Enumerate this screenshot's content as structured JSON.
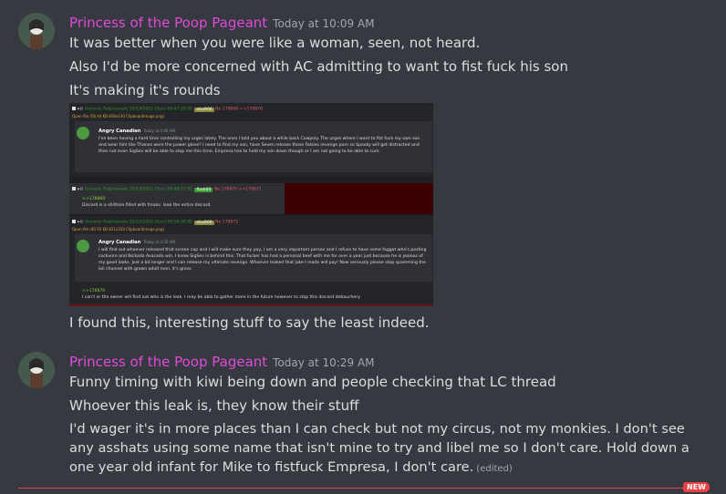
{
  "messages": [
    {
      "username": "Princess of the Poop Pageant",
      "timestamp": "Today at 10:09 AM",
      "lines": [
        "It was better when you were like a woman, seen, not heard.",
        "Also I'd be more concerned with AC admitting to want to fist fuck his son",
        "It's making it's rounds",
        "I found this, interesting stuff to say the least indeed."
      ],
      "embed": {
        "post1": {
          "header": "Unironic Ralphamale  10/23/2022 (Sun) 09:47:20 ID:",
          "id": "eba906",
          "num": "No.178869",
          "replies": ">>178876",
          "file": "Open file (58.44 KB 836x130 Clipboardimage.png)",
          "quote_name": "Angry Canadian",
          "quote_time": "Today at 4:46 AM",
          "quote_text": "I've been having a hard time controlling my urges lately. The ones I told you about a while back Cowpoly. The urges where I want to fist fuck my own son and wear him like Thanos wore the power glove? I need to find my son, have Seven release those Falsies revenge porn so Spooky will get distracted and then not even SigSev will be able to stop me this time. Empresa has to hold my son down though or I am not going to be able to cum."
        },
        "post2": {
          "header": "Unironic Ralphamale  10/23/2022 (Sun) 09:48:57 ID:",
          "id": "fbab00",
          "num": "No.178870",
          "replies": ">>178871",
          "reply_link": ">>178869",
          "text": "Discord is a shithole filled with freaks. leak the entire discord."
        },
        "post3": {
          "header": "Unironic Ralphamale  10/23/2022 (Sun) 09:56:08 ID:",
          "id": "eba906",
          "num": "No.178871",
          "file": "Open file (40.93 KB 831x150 Clipboardimage.png)",
          "quote_name": "Angry Canadian",
          "quote_time": "Today at 4:35 AM",
          "quote_text": "I will find out whoever released that screen cap and I will make sure they pay, I am a very important person and I refuse to have some faggot who's posting cockvore and Nickado Avacado win. I know SigSev is behind this. That fucker has had a personal beef with me for over a year just because he is jealous of my good looks. Just a bit longer and I can release my ultimate revenge. Whoever leaked that joke I made will pay! Now seriously please stop spamming the loli channel with grown adult men, it's gross.",
          "reply_link": ">>178870",
          "text": "I can't or the owner will find out who is the leak. I may be able to gather more in the future however to stop this discord debauchery."
        }
      }
    },
    {
      "username": "Princess of the Poop Pageant",
      "timestamp": "Today at 10:29 AM",
      "lines": [
        "Funny timing with kiwi being down and people checking that LC thread",
        "Whoever this leak is, they know their stuff",
        "I'd wager it's in more places than I can check but not my circus, not my monkies. I don't see any asshats using some name that isn't mine to try and libel me so I don't care. Hold down a one year old infant for Mike to fistfuck Empresa, I don't care."
      ],
      "edited_label": "(edited)"
    }
  ],
  "new_badge": "NEW",
  "colors": {
    "background": "#36393f",
    "username": "#e04ad8",
    "timestamp": "#a3a6aa",
    "text": "#dcddde",
    "new_divider": "#ed4245"
  }
}
